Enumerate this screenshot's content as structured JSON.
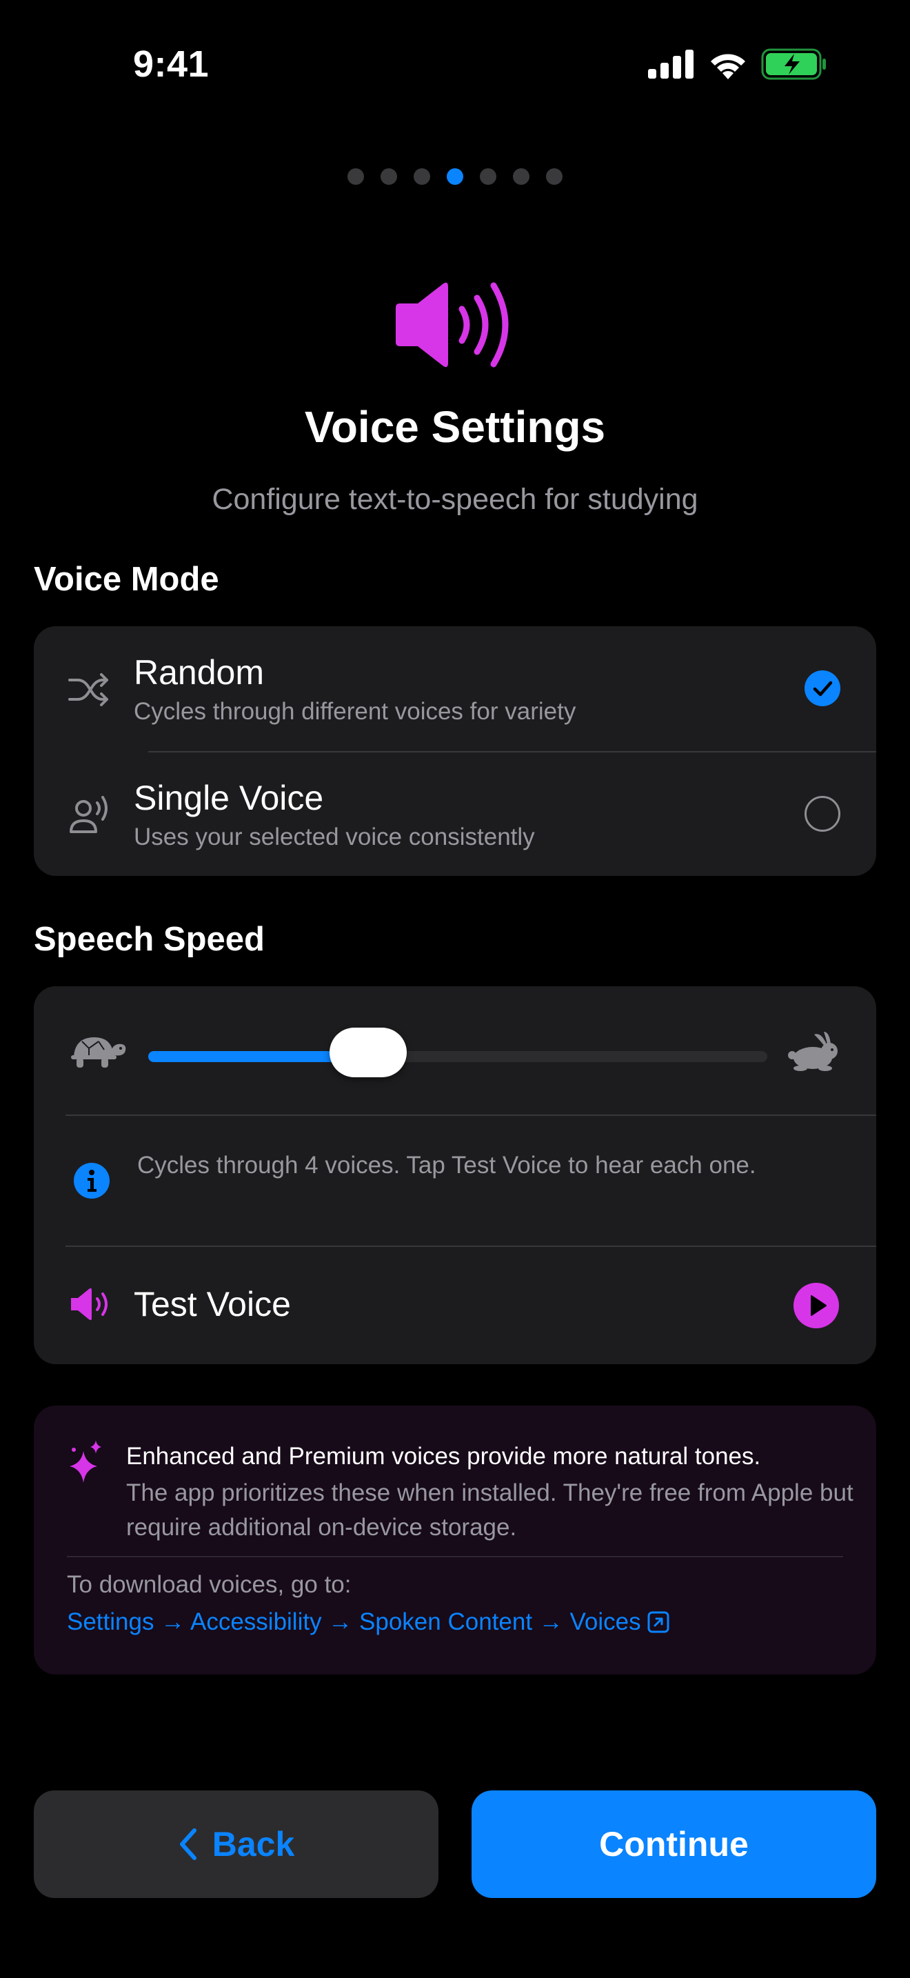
{
  "status_bar": {
    "time": "9:41"
  },
  "pager": {
    "count": 7,
    "active_index": 3
  },
  "header": {
    "title": "Voice Settings",
    "subtitle": "Configure text-to-speech for studying"
  },
  "voice_mode": {
    "section_label": "Voice Mode",
    "options": [
      {
        "title": "Random",
        "description": "Cycles through different voices for variety",
        "icon": "shuffle-icon",
        "selected": true
      },
      {
        "title": "Single Voice",
        "description": "Uses your selected voice consistently",
        "icon": "person-wave-icon",
        "selected": false
      }
    ]
  },
  "speech_speed": {
    "section_label": "Speech Speed",
    "slider_value_fraction": 0.355,
    "info_text": "Cycles through 4 voices. Tap Test Voice to hear each one.",
    "test_voice_label": "Test Voice"
  },
  "tip": {
    "headline": "Enhanced and Premium voices provide more natural tones.",
    "body": "The app prioritizes these when installed. They're free from Apple but require additional on-device storage.",
    "download_label": "To download voices, go to:",
    "download_path": "Settings → Accessibility → Spoken Content → Voices"
  },
  "buttons": {
    "back": "Back",
    "continue": "Continue"
  },
  "colors": {
    "accent": "#0a84ff",
    "magenta": "#d735e8",
    "card": "#1c1c1e",
    "background": "#000000"
  }
}
